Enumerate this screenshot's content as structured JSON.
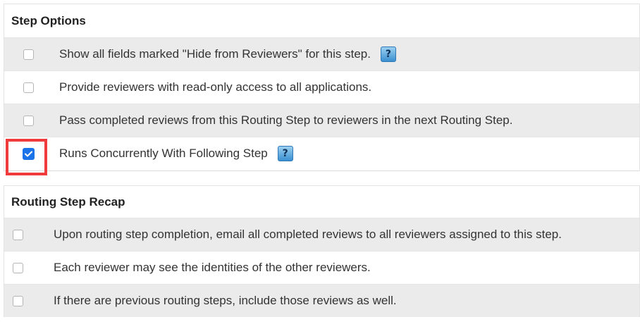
{
  "step_options": {
    "title": "Step Options",
    "items": [
      {
        "label": "Show all fields marked \"Hide from Reviewers\" for this step.",
        "checked": false,
        "help": "?"
      },
      {
        "label": "Provide reviewers with read-only access to all applications.",
        "checked": false
      },
      {
        "label": "Pass completed reviews from this Routing Step to reviewers in the next Routing Step.",
        "checked": false
      },
      {
        "label": "Runs Concurrently With Following Step",
        "checked": true,
        "help": "?"
      }
    ]
  },
  "routing_step_recap": {
    "title": "Routing Step Recap",
    "items": [
      {
        "label": "Upon routing step completion, email all completed reviews to all reviewers assigned to this step.",
        "checked": false
      },
      {
        "label": "Each reviewer may see the identities of the other reviewers.",
        "checked": false
      },
      {
        "label": "If there are previous routing steps, include those reviews as well.",
        "checked": false
      }
    ]
  },
  "colors": {
    "highlight": "#ef3b3b",
    "checkbox_checked": "#1a73e8",
    "row_shaded": "#ebebeb"
  }
}
